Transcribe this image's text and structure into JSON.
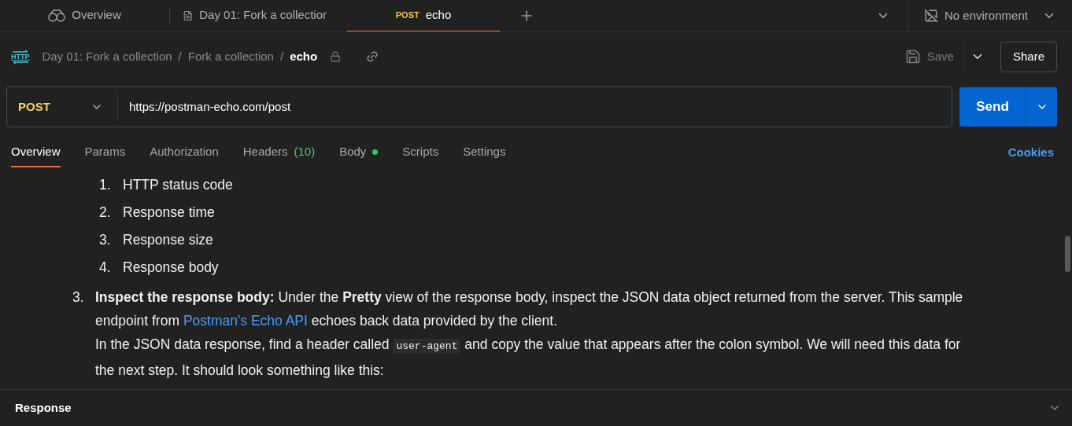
{
  "top_tabs": [
    {
      "kind": "overview",
      "label": "Overview",
      "selected": false
    },
    {
      "kind": "document",
      "label": "Day 01: Fork a collectior",
      "selected": false
    },
    {
      "kind": "request",
      "method": "POST",
      "label": "echo",
      "selected": true
    }
  ],
  "environment": {
    "label": "No environment"
  },
  "breadcrumb": {
    "badge": "HTTP",
    "parts": [
      "Day 01: Fork a collection",
      "Fork a collection"
    ],
    "current": "echo",
    "separator": "/"
  },
  "actions": {
    "save": "Save",
    "save_disabled": true,
    "share": "Share"
  },
  "request": {
    "method": "POST",
    "url": "https://postman-echo.com/post",
    "send": "Send"
  },
  "request_tabs": [
    {
      "label": "Overview",
      "selected": true
    },
    {
      "label": "Params",
      "selected": false
    },
    {
      "label": "Authorization",
      "selected": false
    },
    {
      "label": "Headers",
      "count": "(10)",
      "selected": false
    },
    {
      "label": "Body",
      "has_content": true,
      "selected": false
    },
    {
      "label": "Scripts",
      "selected": false
    },
    {
      "label": "Settings",
      "selected": false
    }
  ],
  "cookies": "Cookies",
  "content": {
    "sub_list": [
      {
        "number": "1.",
        "text": "HTTP status code"
      },
      {
        "number": "2.",
        "text": "Response time"
      },
      {
        "number": "3.",
        "text": "Response size"
      },
      {
        "number": "4.",
        "text": "Response body"
      }
    ],
    "item": {
      "number": "3.",
      "paragraphs": [
        [
          {
            "kind": "text",
            "text": "**Inspect the response body:** Under the **Pretty** view of the response body, inspect the JSON data object returned from the server. This sample endpoint from "
          },
          {
            "kind": "link",
            "text": "Postman's Echo API"
          },
          {
            "kind": "text",
            "text": " echoes back data provided by the client."
          }
        ],
        [
          {
            "kind": "text",
            "text": "In the JSON data response, find a header called "
          },
          {
            "kind": "code",
            "text": "user-agent"
          },
          {
            "kind": "text",
            "text": " and copy the value that appears after the colon symbol. We will need this data for the next step. It should look something like this:"
          }
        ]
      ]
    }
  },
  "response": {
    "title": "Response"
  }
}
